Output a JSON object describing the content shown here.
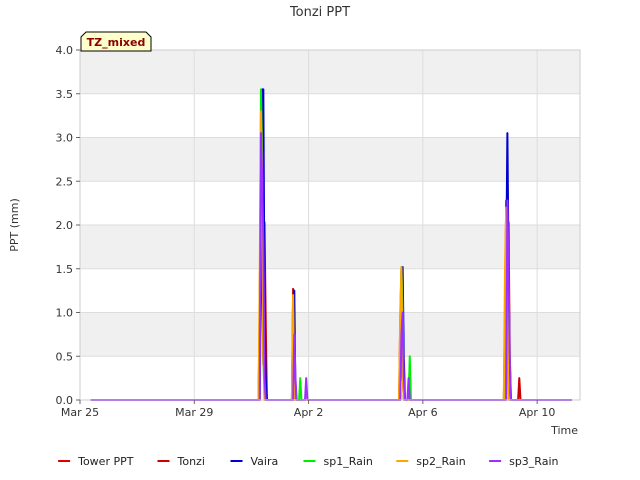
{
  "chart_data": {
    "type": "line",
    "title": "Tonzi PPT",
    "xlabel": "Time",
    "ylabel": "PPT (mm)",
    "badge": "TZ_mixed",
    "ylim": [
      0,
      4.0
    ],
    "yticks": [
      "0.0",
      "0.5",
      "1.0",
      "1.5",
      "2.0",
      "2.5",
      "3.0",
      "3.5",
      "4.0"
    ],
    "xlim": [
      "2024-03-25",
      "2024-04-11T12:00"
    ],
    "xticks": [
      {
        "date": "2024-03-25",
        "label": "Mar 25"
      },
      {
        "date": "2024-03-29",
        "label": "Mar 29"
      },
      {
        "date": "2024-04-02",
        "label": "Apr 2"
      },
      {
        "date": "2024-04-06",
        "label": "Apr 6"
      },
      {
        "date": "2024-04-10",
        "label": "Apr 10"
      }
    ],
    "series": [
      {
        "name": "Tower PPT",
        "color": "#dd0000",
        "points": []
      },
      {
        "name": "Tonzi",
        "color": "#cc0000",
        "points": [
          [
            "2024-03-25T09:00",
            0
          ],
          [
            "2024-03-31T06:00",
            0
          ],
          [
            "2024-03-31T07:00",
            1.2
          ],
          [
            "2024-03-31T08:00",
            2.8
          ],
          [
            "2024-03-31T09:00",
            1.5
          ],
          [
            "2024-03-31T10:00",
            0.4
          ],
          [
            "2024-03-31T11:00",
            2.03
          ],
          [
            "2024-03-31T12:00",
            0.9
          ],
          [
            "2024-03-31T13:00",
            0
          ],
          [
            "2024-04-01T10:00",
            0
          ],
          [
            "2024-04-01T11:00",
            1.27
          ],
          [
            "2024-04-01T12:00",
            0
          ],
          [
            "2024-04-05T04:00",
            0
          ],
          [
            "2024-04-05T05:00",
            0.9
          ],
          [
            "2024-04-05T06:00",
            1.5
          ],
          [
            "2024-04-05T07:00",
            0.3
          ],
          [
            "2024-04-05T08:00",
            0
          ],
          [
            "2024-04-08T20:00",
            0
          ],
          [
            "2024-04-08T21:00",
            1.0
          ],
          [
            "2024-04-08T22:00",
            2.28
          ],
          [
            "2024-04-08T23:00",
            1.2
          ],
          [
            "2024-04-09T00:00",
            2.03
          ],
          [
            "2024-04-09T01:00",
            0.5
          ],
          [
            "2024-04-09T02:00",
            0
          ],
          [
            "2024-04-09T08:00",
            0
          ],
          [
            "2024-04-09T09:00",
            0.25
          ],
          [
            "2024-04-09T10:00",
            0
          ],
          [
            "2024-04-11T05:00",
            0
          ]
        ]
      },
      {
        "name": "Vaira",
        "color": "#0000cc",
        "points": [
          [
            "2024-03-25T09:00",
            0
          ],
          [
            "2024-03-31T07:00",
            0
          ],
          [
            "2024-03-31T08:00",
            1.8
          ],
          [
            "2024-03-31T09:00",
            3.55
          ],
          [
            "2024-03-31T10:00",
            3.55
          ],
          [
            "2024-03-31T11:00",
            1.0
          ],
          [
            "2024-03-31T12:00",
            0.25
          ],
          [
            "2024-03-31T13:00",
            0
          ],
          [
            "2024-04-01T11:00",
            0
          ],
          [
            "2024-04-01T12:00",
            1.25
          ],
          [
            "2024-04-01T13:00",
            0
          ],
          [
            "2024-04-05T05:00",
            0
          ],
          [
            "2024-04-05T06:00",
            1.0
          ],
          [
            "2024-04-05T07:00",
            1.52
          ],
          [
            "2024-04-05T08:00",
            0.5
          ],
          [
            "2024-04-05T09:00",
            0
          ],
          [
            "2024-04-08T21:00",
            0
          ],
          [
            "2024-04-08T22:00",
            1.5
          ],
          [
            "2024-04-08T23:00",
            3.05
          ],
          [
            "2024-04-09T00:00",
            1.5
          ],
          [
            "2024-04-09T01:00",
            0.25
          ],
          [
            "2024-04-09T02:00",
            0
          ],
          [
            "2024-04-11T05:00",
            0
          ]
        ]
      },
      {
        "name": "sp1_Rain",
        "color": "#00ee00",
        "points": [
          [
            "2024-03-25T09:00",
            0
          ],
          [
            "2024-03-31T06:00",
            0
          ],
          [
            "2024-03-31T07:00",
            1.0
          ],
          [
            "2024-03-31T08:00",
            3.55
          ],
          [
            "2024-03-31T09:00",
            2.8
          ],
          [
            "2024-03-31T10:00",
            0.5
          ],
          [
            "2024-03-31T11:00",
            0
          ],
          [
            "2024-04-01T10:00",
            0
          ],
          [
            "2024-04-01T11:00",
            1.0
          ],
          [
            "2024-04-01T12:00",
            0
          ],
          [
            "2024-04-01T16:00",
            0
          ],
          [
            "2024-04-01T17:00",
            0.25
          ],
          [
            "2024-04-01T18:00",
            0
          ],
          [
            "2024-04-05T05:00",
            0
          ],
          [
            "2024-04-05T06:00",
            1.52
          ],
          [
            "2024-04-05T07:00",
            1.0
          ],
          [
            "2024-04-05T08:00",
            0
          ],
          [
            "2024-04-05T12:00",
            0
          ],
          [
            "2024-04-05T13:00",
            0.5
          ],
          [
            "2024-04-05T14:00",
            0
          ],
          [
            "2024-04-08T21:00",
            0
          ],
          [
            "2024-04-08T22:00",
            2.0
          ],
          [
            "2024-04-08T23:00",
            1.0
          ],
          [
            "2024-04-09T00:00",
            0
          ],
          [
            "2024-04-11T05:00",
            0
          ]
        ]
      },
      {
        "name": "sp2_Rain",
        "color": "#ffa500",
        "points": [
          [
            "2024-03-25T09:00",
            0
          ],
          [
            "2024-03-31T06:00",
            0
          ],
          [
            "2024-03-31T07:00",
            1.5
          ],
          [
            "2024-03-31T08:00",
            3.3
          ],
          [
            "2024-03-31T09:00",
            2.5
          ],
          [
            "2024-03-31T10:00",
            0.6
          ],
          [
            "2024-03-31T11:00",
            0
          ],
          [
            "2024-04-01T10:00",
            0
          ],
          [
            "2024-04-01T11:00",
            1.2
          ],
          [
            "2024-04-01T12:00",
            0
          ],
          [
            "2024-04-05T04:00",
            0
          ],
          [
            "2024-04-05T05:00",
            1.0
          ],
          [
            "2024-04-05T06:00",
            1.52
          ],
          [
            "2024-04-05T07:00",
            0.3
          ],
          [
            "2024-04-05T08:00",
            0
          ],
          [
            "2024-04-08T20:00",
            0
          ],
          [
            "2024-04-08T21:00",
            1.5
          ],
          [
            "2024-04-08T22:00",
            2.2
          ],
          [
            "2024-04-08T23:00",
            0.8
          ],
          [
            "2024-04-09T00:00",
            0
          ],
          [
            "2024-04-11T05:00",
            0
          ]
        ]
      },
      {
        "name": "sp3_Rain",
        "color": "#9b30ff",
        "points": [
          [
            "2024-03-25T09:00",
            0
          ],
          [
            "2024-03-31T07:00",
            0
          ],
          [
            "2024-03-31T08:00",
            3.05
          ],
          [
            "2024-03-31T09:00",
            2.55
          ],
          [
            "2024-03-31T10:00",
            1.8
          ],
          [
            "2024-03-31T11:00",
            0.25
          ],
          [
            "2024-03-31T12:00",
            0
          ],
          [
            "2024-04-01T11:00",
            0
          ],
          [
            "2024-04-01T12:00",
            0.75
          ],
          [
            "2024-04-01T13:00",
            0.25
          ],
          [
            "2024-04-01T14:00",
            0
          ],
          [
            "2024-04-01T21:00",
            0
          ],
          [
            "2024-04-01T22:00",
            0.25
          ],
          [
            "2024-04-01T23:00",
            0
          ],
          [
            "2024-04-05T05:00",
            0
          ],
          [
            "2024-04-05T06:00",
            0.75
          ],
          [
            "2024-04-05T07:00",
            1.0
          ],
          [
            "2024-04-05T08:00",
            0.25
          ],
          [
            "2024-04-05T09:00",
            0
          ],
          [
            "2024-04-05T11:00",
            0
          ],
          [
            "2024-04-05T12:00",
            0.25
          ],
          [
            "2024-04-05T13:00",
            0
          ],
          [
            "2024-04-08T22:00",
            0
          ],
          [
            "2024-04-08T23:00",
            2.28
          ],
          [
            "2024-04-09T00:00",
            1.5
          ],
          [
            "2024-04-09T01:00",
            0.5
          ],
          [
            "2024-04-09T02:00",
            0
          ],
          [
            "2024-04-11T05:00",
            0
          ]
        ]
      }
    ],
    "legend_position": "bottom"
  }
}
